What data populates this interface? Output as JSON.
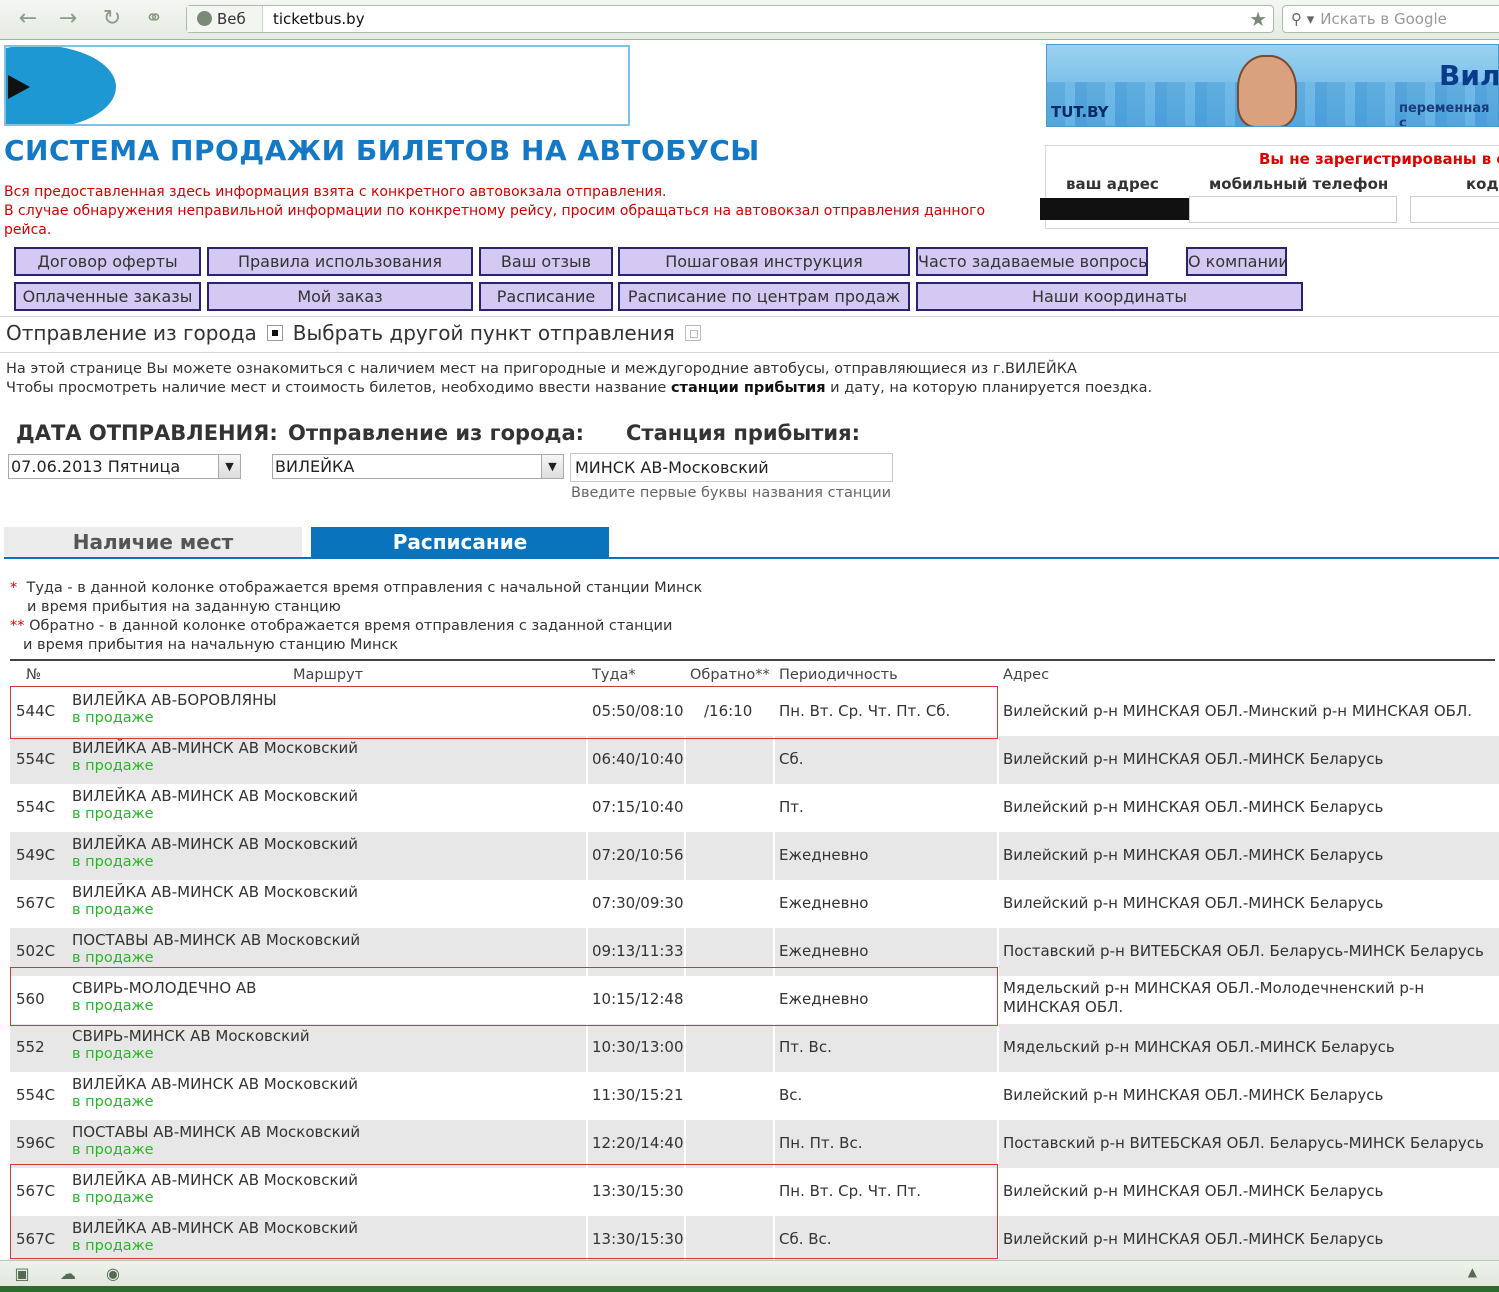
{
  "browser": {
    "back_icon": "arrow-left-icon",
    "web_label": "Веб",
    "url": "ticketbus.by",
    "search_placeholder": "Искать в Google"
  },
  "banner": {
    "brand": "TUT.BY",
    "headline": "Вил",
    "subline": "переменная с"
  },
  "page_title": "СИСТЕМА ПРОДАЖИ БИЛЕТОВ НА АВТОБУСЫ",
  "notice": {
    "line1": "Вся предоставленная здесь информация взята с конкретного автовокзала отправления.",
    "line2": "В случае обнаружения неправильной информации по конкретному рейсу, просим обращаться на автовокзал отправления данного рейса."
  },
  "login": {
    "not_registered": "Вы не зарегистрированы в сис",
    "address_label": "ваш адрес",
    "phone_label": "мобильный телефон",
    "code_label": "код"
  },
  "nav": {
    "offer": "Договор оферты",
    "rules": "Правила использования",
    "feedback": "Ваш отзыв",
    "instructions": "Пошаговая инструкция",
    "faq": "Часто задаваемые вопросы",
    "about": "О компании",
    "paid_orders": "Оплаченные заказы",
    "my_order": "Мой заказ",
    "schedule": "Расписание",
    "schedule_centers": "Расписание по центрам продаж",
    "coordinates": "Наши координаты"
  },
  "departure_choice": {
    "from_city": "Отправление из города",
    "other_point": "Выбрать другой пункт отправления"
  },
  "info": {
    "line1": "На этой странице Вы можете ознакомиться с наличием мест на пригородные и междугородние автобусы, отправляющиеся из г.ВИЛЕЙКА",
    "line2_a": "Чтобы просмотреть наличие мест и стоимость билетов, необходимо ввести название ",
    "line2_b": "станции прибытия",
    "line2_c": " и дату, на которую планируется поездка."
  },
  "form": {
    "date_label": "ДАТА ОТПРАВЛЕНИЯ:",
    "date_value": "07.06.2013 Пятница",
    "city_label": "Отправление из города:",
    "city_value": "ВИЛЕЙКА",
    "station_label": "Станция прибытия:",
    "station_value": "МИНСК АВ-Московский",
    "station_hint": "Введите первые буквы названия станции"
  },
  "tabs": {
    "seats": "Наличие мест",
    "schedule": "Расписание"
  },
  "legend": {
    "mark1": "*",
    "text1a": "Туда - в данной колонке отображается время отправления с начальной станции Минск",
    "text1b": "и время прибытия на заданную станцию",
    "mark2": "**",
    "text2a": "Обратно - в данной колонке отображается время отправления с заданной станции",
    "text2b": "и время прибытия на начальную станцию Минск"
  },
  "table": {
    "headers": {
      "num": "№",
      "route": "Маршрут",
      "tuda": "Туда*",
      "obratno": "Обратно**",
      "period": "Периодичность",
      "address": "Адрес"
    },
    "sale_label": "в продаже",
    "rows": [
      {
        "num": "544С",
        "route": "ВИЛЕЙКА АВ-БОРОВЛЯНЫ",
        "tuda": "05:50/08:10",
        "obratno": "/16:10",
        "period": "Пн. Вт. Ср. Чт. Пт. Сб.",
        "address": "Вилейский р-н МИНСКАЯ ОБЛ.-Минский р-н МИНСКАЯ ОБЛ."
      },
      {
        "num": "554С",
        "route": "ВИЛЕЙКА АВ-МИНСК АВ Московский",
        "tuda": "06:40/10:40",
        "obratno": "",
        "period": "Сб.",
        "address": "Вилейский р-н МИНСКАЯ ОБЛ.-МИНСК Беларусь"
      },
      {
        "num": "554С",
        "route": "ВИЛЕЙКА АВ-МИНСК АВ Московский",
        "tuda": "07:15/10:40",
        "obratno": "",
        "period": "Пт.",
        "address": "Вилейский р-н МИНСКАЯ ОБЛ.-МИНСК Беларусь"
      },
      {
        "num": "549С",
        "route": "ВИЛЕЙКА АВ-МИНСК АВ Московский",
        "tuda": "07:20/10:56",
        "obratno": "",
        "period": "Ежедневно",
        "address": "Вилейский р-н МИНСКАЯ ОБЛ.-МИНСК Беларусь"
      },
      {
        "num": "567С",
        "route": "ВИЛЕЙКА АВ-МИНСК АВ Московский",
        "tuda": "07:30/09:30",
        "obratno": "",
        "period": "Ежедневно",
        "address": "Вилейский р-н МИНСКАЯ ОБЛ.-МИНСК Беларусь"
      },
      {
        "num": "502С",
        "route": "ПОСТАВЫ АВ-МИНСК АВ Московский",
        "tuda": "09:13/11:33",
        "obratno": "",
        "period": "Ежедневно",
        "address": "Поставский р-н ВИТЕБСКАЯ ОБЛ. Беларусь-МИНСК Беларусь"
      },
      {
        "num": "560",
        "route": "СВИРЬ-МОЛОДЕЧНО АВ",
        "tuda": "10:15/12:48",
        "obratno": "",
        "period": "Ежедневно",
        "address": "Мядельский р-н МИНСКАЯ ОБЛ.-Молодечненский р-н МИНСКАЯ ОБЛ."
      },
      {
        "num": "552",
        "route": "СВИРЬ-МИНСК АВ Московский",
        "tuda": "10:30/13:00",
        "obratno": "",
        "period": "Пт. Вс.",
        "address": "Мядельский р-н МИНСКАЯ ОБЛ.-МИНСК Беларусь"
      },
      {
        "num": "554С",
        "route": "ВИЛЕЙКА АВ-МИНСК АВ Московский",
        "tuda": "11:30/15:21",
        "obratno": "",
        "period": "Вс.",
        "address": "Вилейский р-н МИНСКАЯ ОБЛ.-МИНСК Беларусь"
      },
      {
        "num": "596С",
        "route": "ПОСТАВЫ АВ-МИНСК АВ Московский",
        "tuda": "12:20/14:40",
        "obratno": "",
        "period": "Пн. Пт. Вс.",
        "address": "Поставский р-н ВИТЕБСКАЯ ОБЛ. Беларусь-МИНСК Беларусь"
      },
      {
        "num": "567С",
        "route": "ВИЛЕЙКА АВ-МИНСК АВ Московский",
        "tuda": "13:30/15:30",
        "obratno": "",
        "period": "Пн. Вт. Ср. Чт. Пт.",
        "address": "Вилейский р-н МИНСКАЯ ОБЛ.-МИНСК Беларусь"
      },
      {
        "num": "567С",
        "route": "ВИЛЕЙКА АВ-МИНСК АВ Московский",
        "tuda": "13:30/15:30",
        "obratno": "",
        "period": "Сб. Вс.",
        "address": "Вилейский р-н МИНСКАЯ ОБЛ.-МИНСК Беларусь"
      }
    ]
  },
  "colors": {
    "title_blue": "#1379c6",
    "notice_red": "#d40000",
    "nav_button_bg": "#d3c9f2",
    "active_tab": "#0a73be",
    "on_sale_green": "#2bb52b",
    "highlight_border": "#d23a3a"
  }
}
